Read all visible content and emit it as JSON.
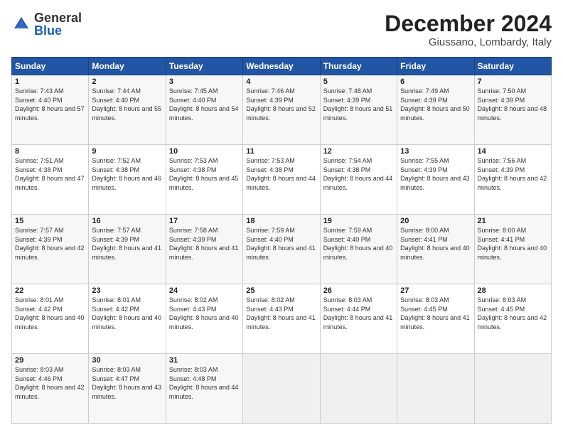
{
  "logo": {
    "general": "General",
    "blue": "Blue"
  },
  "header": {
    "month": "December 2024",
    "location": "Giussano, Lombardy, Italy"
  },
  "weekdays": [
    "Sunday",
    "Monday",
    "Tuesday",
    "Wednesday",
    "Thursday",
    "Friday",
    "Saturday"
  ],
  "weeks": [
    [
      {
        "day": "1",
        "sunrise": "Sunrise: 7:43 AM",
        "sunset": "Sunset: 4:40 PM",
        "daylight": "Daylight: 8 hours and 57 minutes."
      },
      {
        "day": "2",
        "sunrise": "Sunrise: 7:44 AM",
        "sunset": "Sunset: 4:40 PM",
        "daylight": "Daylight: 8 hours and 55 minutes."
      },
      {
        "day": "3",
        "sunrise": "Sunrise: 7:45 AM",
        "sunset": "Sunset: 4:40 PM",
        "daylight": "Daylight: 8 hours and 54 minutes."
      },
      {
        "day": "4",
        "sunrise": "Sunrise: 7:46 AM",
        "sunset": "Sunset: 4:39 PM",
        "daylight": "Daylight: 8 hours and 52 minutes."
      },
      {
        "day": "5",
        "sunrise": "Sunrise: 7:48 AM",
        "sunset": "Sunset: 4:39 PM",
        "daylight": "Daylight: 8 hours and 51 minutes."
      },
      {
        "day": "6",
        "sunrise": "Sunrise: 7:49 AM",
        "sunset": "Sunset: 4:39 PM",
        "daylight": "Daylight: 8 hours and 50 minutes."
      },
      {
        "day": "7",
        "sunrise": "Sunrise: 7:50 AM",
        "sunset": "Sunset: 4:39 PM",
        "daylight": "Daylight: 8 hours and 48 minutes."
      }
    ],
    [
      {
        "day": "8",
        "sunrise": "Sunrise: 7:51 AM",
        "sunset": "Sunset: 4:38 PM",
        "daylight": "Daylight: 8 hours and 47 minutes."
      },
      {
        "day": "9",
        "sunrise": "Sunrise: 7:52 AM",
        "sunset": "Sunset: 4:38 PM",
        "daylight": "Daylight: 8 hours and 46 minutes."
      },
      {
        "day": "10",
        "sunrise": "Sunrise: 7:53 AM",
        "sunset": "Sunset: 4:38 PM",
        "daylight": "Daylight: 8 hours and 45 minutes."
      },
      {
        "day": "11",
        "sunrise": "Sunrise: 7:53 AM",
        "sunset": "Sunset: 4:38 PM",
        "daylight": "Daylight: 8 hours and 44 minutes."
      },
      {
        "day": "12",
        "sunrise": "Sunrise: 7:54 AM",
        "sunset": "Sunset: 4:38 PM",
        "daylight": "Daylight: 8 hours and 44 minutes."
      },
      {
        "day": "13",
        "sunrise": "Sunrise: 7:55 AM",
        "sunset": "Sunset: 4:39 PM",
        "daylight": "Daylight: 8 hours and 43 minutes."
      },
      {
        "day": "14",
        "sunrise": "Sunrise: 7:56 AM",
        "sunset": "Sunset: 4:39 PM",
        "daylight": "Daylight: 8 hours and 42 minutes."
      }
    ],
    [
      {
        "day": "15",
        "sunrise": "Sunrise: 7:57 AM",
        "sunset": "Sunset: 4:39 PM",
        "daylight": "Daylight: 8 hours and 42 minutes."
      },
      {
        "day": "16",
        "sunrise": "Sunrise: 7:57 AM",
        "sunset": "Sunset: 4:39 PM",
        "daylight": "Daylight: 8 hours and 41 minutes."
      },
      {
        "day": "17",
        "sunrise": "Sunrise: 7:58 AM",
        "sunset": "Sunset: 4:39 PM",
        "daylight": "Daylight: 8 hours and 41 minutes."
      },
      {
        "day": "18",
        "sunrise": "Sunrise: 7:59 AM",
        "sunset": "Sunset: 4:40 PM",
        "daylight": "Daylight: 8 hours and 41 minutes."
      },
      {
        "day": "19",
        "sunrise": "Sunrise: 7:59 AM",
        "sunset": "Sunset: 4:40 PM",
        "daylight": "Daylight: 8 hours and 40 minutes."
      },
      {
        "day": "20",
        "sunrise": "Sunrise: 8:00 AM",
        "sunset": "Sunset: 4:41 PM",
        "daylight": "Daylight: 8 hours and 40 minutes."
      },
      {
        "day": "21",
        "sunrise": "Sunrise: 8:00 AM",
        "sunset": "Sunset: 4:41 PM",
        "daylight": "Daylight: 8 hours and 40 minutes."
      }
    ],
    [
      {
        "day": "22",
        "sunrise": "Sunrise: 8:01 AM",
        "sunset": "Sunset: 4:42 PM",
        "daylight": "Daylight: 8 hours and 40 minutes."
      },
      {
        "day": "23",
        "sunrise": "Sunrise: 8:01 AM",
        "sunset": "Sunset: 4:42 PM",
        "daylight": "Daylight: 8 hours and 40 minutes."
      },
      {
        "day": "24",
        "sunrise": "Sunrise: 8:02 AM",
        "sunset": "Sunset: 4:43 PM",
        "daylight": "Daylight: 8 hours and 40 minutes."
      },
      {
        "day": "25",
        "sunrise": "Sunrise: 8:02 AM",
        "sunset": "Sunset: 4:43 PM",
        "daylight": "Daylight: 8 hours and 41 minutes."
      },
      {
        "day": "26",
        "sunrise": "Sunrise: 8:03 AM",
        "sunset": "Sunset: 4:44 PM",
        "daylight": "Daylight: 8 hours and 41 minutes."
      },
      {
        "day": "27",
        "sunrise": "Sunrise: 8:03 AM",
        "sunset": "Sunset: 4:45 PM",
        "daylight": "Daylight: 8 hours and 41 minutes."
      },
      {
        "day": "28",
        "sunrise": "Sunrise: 8:03 AM",
        "sunset": "Sunset: 4:45 PM",
        "daylight": "Daylight: 8 hours and 42 minutes."
      }
    ],
    [
      {
        "day": "29",
        "sunrise": "Sunrise: 8:03 AM",
        "sunset": "Sunset: 4:46 PM",
        "daylight": "Daylight: 8 hours and 42 minutes."
      },
      {
        "day": "30",
        "sunrise": "Sunrise: 8:03 AM",
        "sunset": "Sunset: 4:47 PM",
        "daylight": "Daylight: 8 hours and 43 minutes."
      },
      {
        "day": "31",
        "sunrise": "Sunrise: 8:03 AM",
        "sunset": "Sunset: 4:48 PM",
        "daylight": "Daylight: 8 hours and 44 minutes."
      },
      null,
      null,
      null,
      null
    ]
  ]
}
